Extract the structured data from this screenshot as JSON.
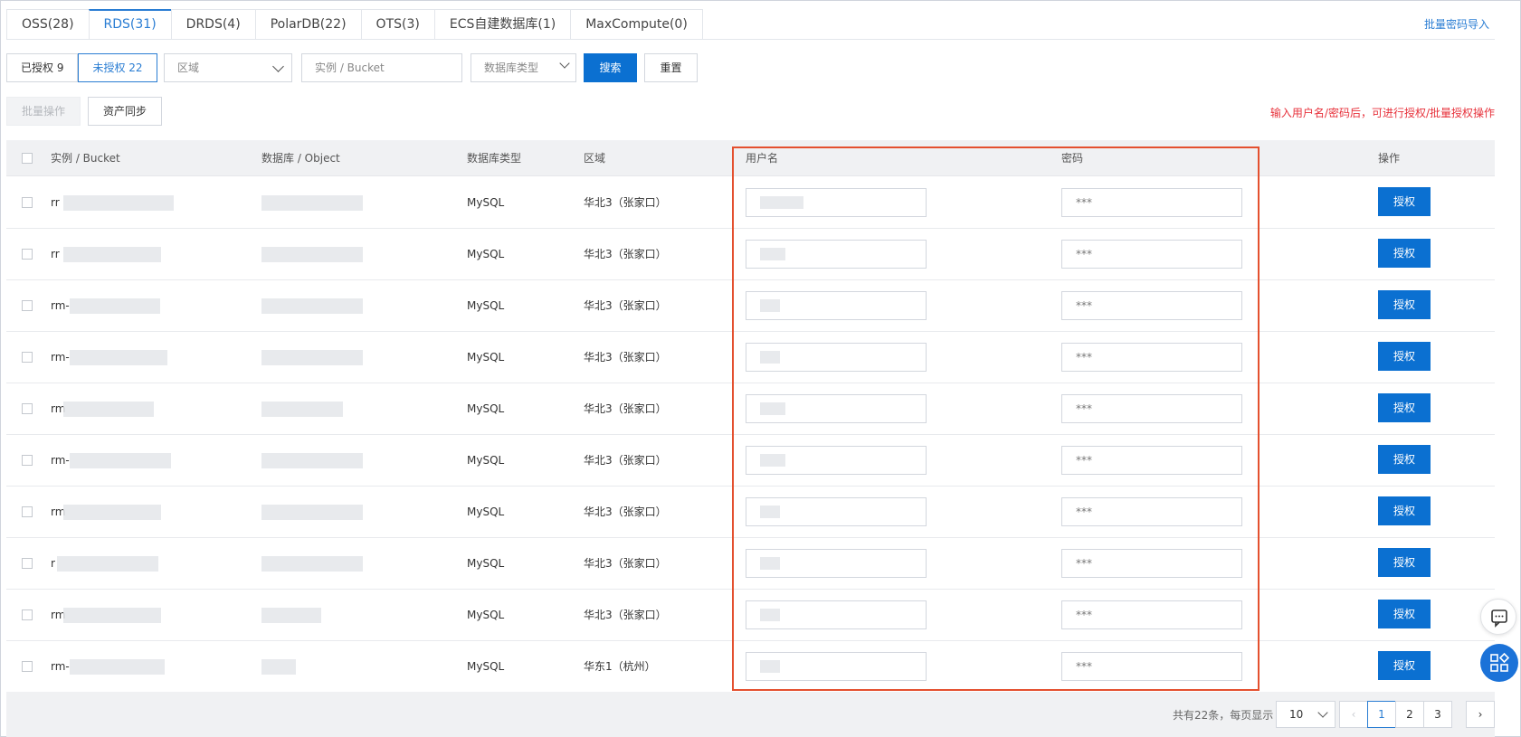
{
  "tabs": [
    {
      "label": "OSS(28)",
      "active": false
    },
    {
      "label": "RDS(31)",
      "active": true
    },
    {
      "label": "DRDS(4)",
      "active": false
    },
    {
      "label": "PolarDB(22)",
      "active": false
    },
    {
      "label": "OTS(3)",
      "active": false
    },
    {
      "label": "ECS自建数据库(1)",
      "active": false
    },
    {
      "label": "MaxCompute(0)",
      "active": false
    }
  ],
  "header": {
    "import_link": "批量密码导入"
  },
  "filters": {
    "authorized": "已授权 9",
    "unauthorized": "未授权 22",
    "region_placeholder": "区域",
    "instance_placeholder": "实例 / Bucket",
    "db_type_placeholder": "数据库类型",
    "search": "搜索",
    "reset": "重置"
  },
  "actions": {
    "batch": "批量操作",
    "sync": "资产同步",
    "hint": "输入用户名/密码后，可进行授权/批量授权操作"
  },
  "table": {
    "headers": {
      "instance": "实例 / Bucket",
      "database": "数据库 / Object",
      "db_type": "数据库类型",
      "region": "区域",
      "username": "用户名",
      "password": "密码",
      "operation": "操作"
    },
    "rows": [
      {
        "instance_prefix": "rr",
        "db_type": "MySQL",
        "region": "华北3（张家口）",
        "password": "***",
        "action": "授权"
      },
      {
        "instance_prefix": "rr",
        "db_type": "MySQL",
        "region": "华北3（张家口）",
        "password": "***",
        "action": "授权"
      },
      {
        "instance_prefix": "rm-",
        "db_type": "MySQL",
        "region": "华北3（张家口）",
        "password": "***",
        "action": "授权"
      },
      {
        "instance_prefix": "rm-",
        "db_type": "MySQL",
        "region": "华北3（张家口）",
        "password": "***",
        "action": "授权"
      },
      {
        "instance_prefix": "rm",
        "db_type": "MySQL",
        "region": "华北3（张家口）",
        "password": "***",
        "action": "授权"
      },
      {
        "instance_prefix": "rm-",
        "db_type": "MySQL",
        "region": "华北3（张家口）",
        "password": "***",
        "action": "授权"
      },
      {
        "instance_prefix": "rm",
        "db_type": "MySQL",
        "region": "华北3（张家口）",
        "password": "***",
        "action": "授权"
      },
      {
        "instance_prefix": "r",
        "db_type": "MySQL",
        "region": "华北3（张家口）",
        "password": "***",
        "action": "授权"
      },
      {
        "instance_prefix": "rm",
        "db_type": "MySQL",
        "region": "华北3（张家口）",
        "password": "***",
        "action": "授权"
      },
      {
        "instance_prefix": "rm-",
        "db_type": "MySQL",
        "region": "华东1（杭州）",
        "password": "***",
        "action": "授权"
      }
    ]
  },
  "pagination": {
    "total": "共有22条，每页显示",
    "page_size": "10",
    "pages": [
      "1",
      "2",
      "3"
    ],
    "current": "1"
  },
  "colors": {
    "accent": "#0b70d1",
    "highlight": "#e4502f",
    "hint": "#e7313b"
  },
  "icons": {
    "chat": "chat-bubble-icon",
    "apps": "app-grid-icon"
  }
}
